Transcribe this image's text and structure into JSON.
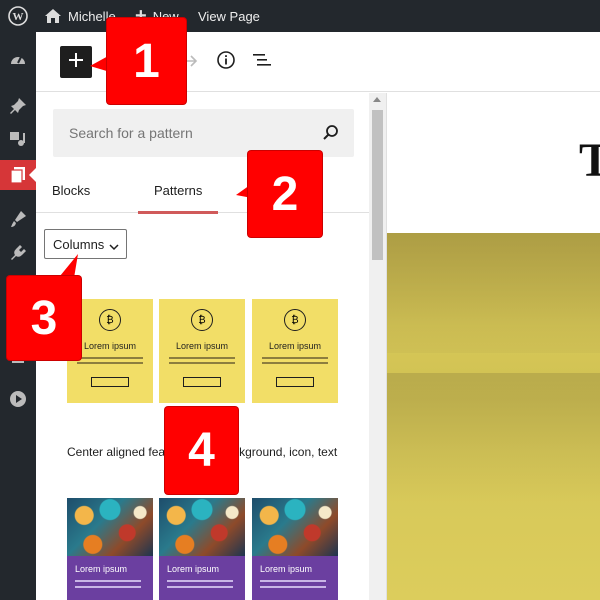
{
  "admin_bar": {
    "site_name": "Michelle",
    "new_label": "New",
    "view_page_label": "View Page"
  },
  "admin_menu": {
    "icons": [
      "dashboard-icon",
      "pin-icon",
      "media-icon",
      "pages-icon",
      "appearance-icon",
      "plugins-icon",
      "users-icon",
      "play-icon"
    ],
    "active": "pages-icon"
  },
  "toolbar": {
    "icons": [
      "add-block-icon",
      "redo-icon",
      "info-icon",
      "list-view-icon"
    ]
  },
  "inserter": {
    "search_placeholder": "Search for a pattern",
    "tabs": [
      {
        "label": "Blocks",
        "active": false
      },
      {
        "label": "Patterns",
        "active": true
      }
    ],
    "category_selected": "Columns",
    "patterns": {
      "yellow_cards": [
        {
          "heading": "Lorem ipsum"
        },
        {
          "heading": "Lorem ipsum"
        },
        {
          "heading": "Lorem ipsum"
        }
      ],
      "pattern_name": "Center aligned features with background, icon, text",
      "art_cards": [
        {
          "heading": "Lorem ipsum"
        },
        {
          "heading": "Lorem ipsum"
        },
        {
          "heading": "Lorem ipsum"
        }
      ]
    }
  },
  "canvas": {
    "title_fragment": "T"
  },
  "callouts": [
    "1",
    "2",
    "3",
    "4"
  ],
  "colors": {
    "admin_bg": "#23282d",
    "active_menu": "#d63638",
    "callout": "#ff0000",
    "pattern_yellow": "#f2de67",
    "pattern_purple": "#6b3fa0",
    "cover_yellow": "#d8c957"
  }
}
